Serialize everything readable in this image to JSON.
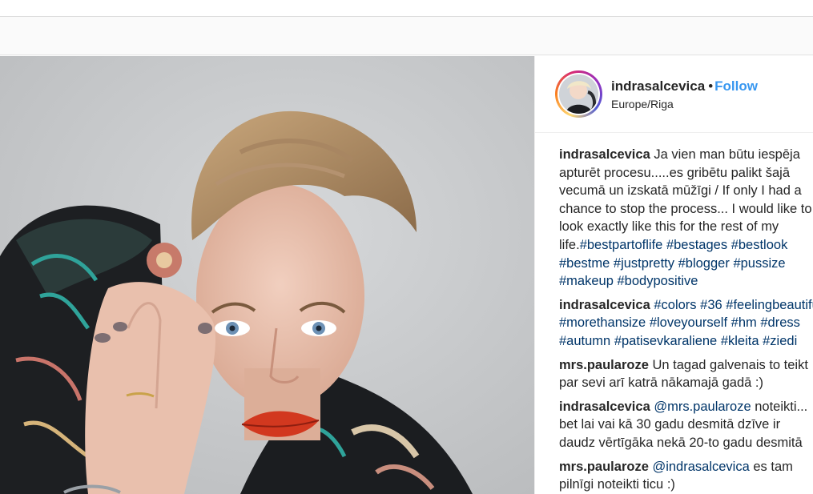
{
  "post": {
    "username": "indrasalcevica",
    "separator": "•",
    "follow_label": "Follow",
    "location": "Europe/Riga"
  },
  "comments": [
    {
      "author": "indrasalcevica",
      "lines": [
        "Ja vien man būtu iespēja",
        "apturēt procesu.....es gribētu palikt šajā",
        "vecumā un izskatā mūžīgi / If only I had a",
        "chance to stop the process... I would like to",
        "look exactly like this for the rest of my"
      ],
      "tail_text": "life.",
      "tags": [
        "#bestpartoflife",
        "#bestages",
        "#bestlook",
        "#bestme",
        "#justpretty",
        "#blogger",
        "#pussize",
        "#makeup",
        "#bodypositive"
      ]
    },
    {
      "author": "indrasalcevica",
      "tags": [
        "#colors",
        "#36",
        "#feelingbeautiful",
        "#morethansize",
        "#loveyourself",
        "#hm",
        "#dress",
        "#autumn",
        "#patisevkaraliene",
        "#kleita",
        "#ziedi"
      ]
    },
    {
      "author": "mrs.paularoze",
      "lines": [
        "Un tagad galvenais to teikt",
        "par sevi arī katrā nākamajā gadā :)"
      ]
    },
    {
      "author": "indrasalcevica",
      "mention": "@mrs.paularoze",
      "lines": [
        "noteikti...",
        "bet lai vai kā 30 gadu desmitā dzīve ir",
        "daudz vērtīgāka nekā 20-to gadu desmitā"
      ]
    },
    {
      "author": "mrs.paularoze",
      "mention": "@indrasalcevica",
      "lines": [
        "es tam",
        "pilnīgi noteikti ticu :)"
      ]
    }
  ]
}
